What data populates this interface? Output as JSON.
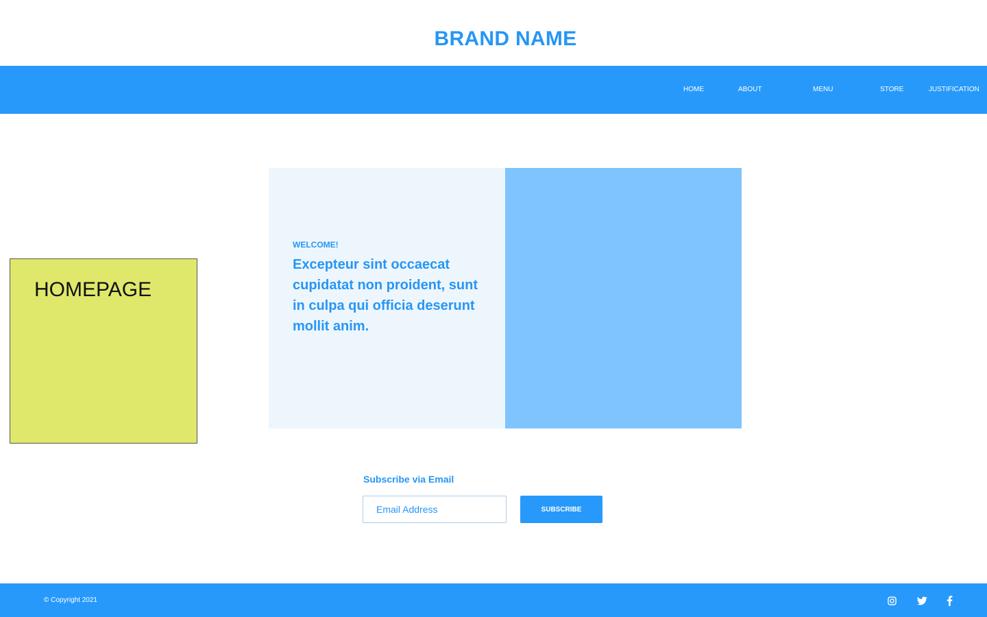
{
  "header": {
    "brand": "BRAND NAME"
  },
  "nav": {
    "items": [
      {
        "label": "HOME"
      },
      {
        "label": "ABOUT"
      },
      {
        "label": "MENU"
      },
      {
        "label": "STORE"
      },
      {
        "label": "JUSTIFICATION"
      }
    ]
  },
  "note": {
    "label": "HOMEPAGE"
  },
  "hero": {
    "eyebrow": "WELCOME!",
    "headline": "Excepteur sint occaecat cupidatat non proident, sunt in culpa qui officia deserunt mollit anim."
  },
  "subscribe": {
    "title": "Subscribe via Email",
    "placeholder": "Email Address",
    "button_label": "SUBSCRIBE"
  },
  "footer": {
    "copyright": "© Copyright 2021",
    "social_icons": [
      "instagram-icon",
      "twitter-icon",
      "facebook-icon"
    ]
  },
  "colors": {
    "brand_blue": "#2799fb",
    "text_blue": "#2696f5",
    "hero_light": "#eef6fd",
    "hero_accent": "#7fc4fd",
    "note_yellow": "#dfe86a"
  }
}
